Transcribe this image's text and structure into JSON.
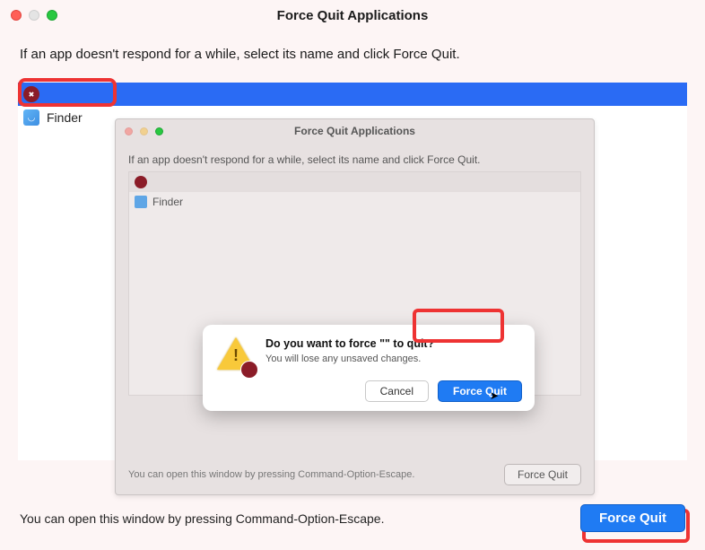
{
  "window": {
    "title": "Force Quit Applications",
    "instruction": "If an app doesn't respond for a while, select its name and click Force Quit."
  },
  "apps": {
    "selected": {
      "name": ""
    },
    "finder": {
      "name": "Finder"
    }
  },
  "inner": {
    "title": "Force Quit Applications",
    "instruction": "If an app doesn't respond for a while, select its name and click Force Quit.",
    "finder": "Finder",
    "footer_hint": "You can open this window by pressing Command-Option-Escape.",
    "footer_button": "Force Quit"
  },
  "modal": {
    "heading": "Do you want to force \"\" to quit?",
    "body": "You will lose any unsaved changes.",
    "cancel": "Cancel",
    "confirm": "Force Quit"
  },
  "outer_footer": {
    "hint": "You can open this window by pressing Command-Option-Escape.",
    "button": "Force Quit"
  }
}
